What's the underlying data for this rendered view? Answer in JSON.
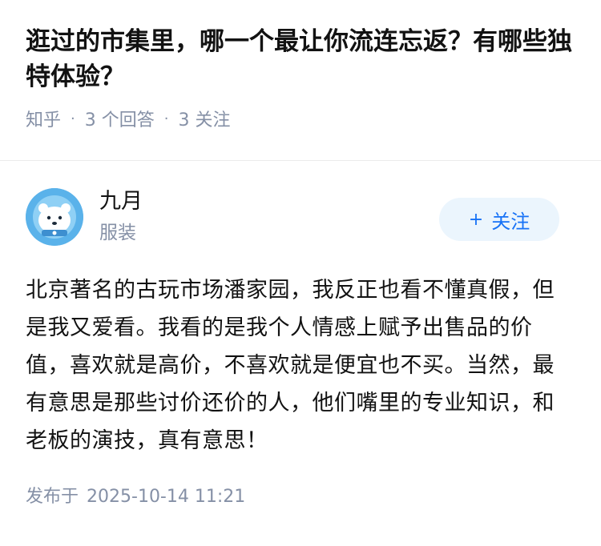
{
  "question": {
    "title": "逛过的市集里，哪一个最让你流连忘返？有哪些独特体验？",
    "source": "知乎",
    "answers": "3 个回答",
    "follows": "3 关注"
  },
  "answer": {
    "author_name": "九月",
    "author_headline": "服装",
    "follow_label": "关注",
    "content": "北京著名的古玩市场潘家园，我反正也看不懂真假，但是我又爱看。我看的是我个人情感上赋予出售品的价值，喜欢就是高价，不喜欢就是便宜也不买。当然，最有意思是那些讨价还价的人，他们嘴里的专业知识，和老板的演技，真有意思！",
    "published_label": "发布于",
    "published_date": "2025-10-14 11:21"
  },
  "colors": {
    "accent": "#1772f6",
    "follow_bg": "#ebf5fd",
    "meta_text": "#8590a6",
    "avatar_bg": "#5ab2ea"
  },
  "icons": {
    "avatar": "polar-bear-avatar-icon",
    "follow": "plus-icon"
  }
}
